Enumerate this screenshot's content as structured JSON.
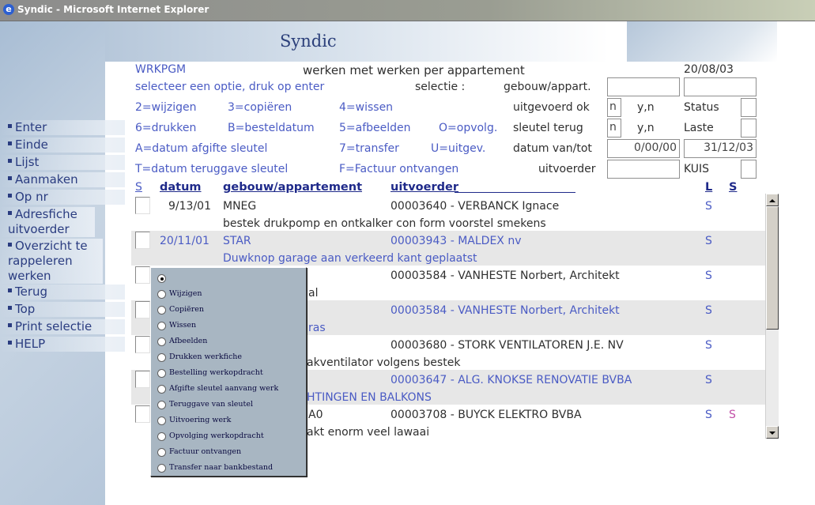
{
  "window": {
    "title": "Syndic - Microsoft Internet Explorer"
  },
  "app": {
    "title": "Syndic"
  },
  "header": {
    "program": "WRKPGM",
    "heading": "werken met werken per appartement",
    "date": "20/08/03",
    "instruction": "selecteer een optie, druk op enter",
    "selection_label": "selectie :",
    "building_label": "gebouw/appart."
  },
  "options": {
    "o1": "2=wijzigen",
    "o2": "3=copiëren",
    "o3": "4=wissen",
    "o4": "6=drukken",
    "o5": "B=besteldatum",
    "o6": "5=afbeelden",
    "o7": "O=opvolg.",
    "o8": "A=datum afgifte sleutel",
    "o9": "7=transfer",
    "o10": "U=uitgev.",
    "o11": "T=datum teruggave sleutel",
    "o12": "F=Factuur ontvangen"
  },
  "filters": {
    "executed_label": "uitgevoerd ok",
    "executed_value": "n",
    "executed_hint": "y,n",
    "status_label": "Status",
    "key_label": "sleutel terug",
    "key_value": "n",
    "key_hint": "y,n",
    "last_label": "Laste",
    "date_label": "datum van/tot",
    "date_from": "0/00/00",
    "date_to": "31/12/03",
    "contractor_label": "uitvoerder",
    "contractor_note": "KUIS"
  },
  "nav": {
    "items": [
      {
        "label": "Enter"
      },
      {
        "label": "Einde"
      },
      {
        "label": "Lijst"
      },
      {
        "label": "Aanmaken"
      },
      {
        "label": "Op nr"
      },
      {
        "label": "Adresfiche uitvoerder"
      },
      {
        "label": "Overzicht te rappeleren werken"
      },
      {
        "label": "Terug"
      },
      {
        "label": "Top"
      },
      {
        "label": "Print selectie"
      },
      {
        "label": "HELP"
      }
    ]
  },
  "table": {
    "headers": {
      "sel": "S",
      "date": "datum",
      "building": "gebouw/appartement",
      "contractor": "uitvoerder",
      "l": "L",
      "s": "S"
    },
    "rows": [
      {
        "date": "9/13/01",
        "building": "MNEG",
        "contractor": "00003640 - VERBANCK Ignace",
        "l": "S",
        "s": "",
        "desc": "bestek drukpomp en ontkalker con form voorstel smekens"
      },
      {
        "date": "20/11/01",
        "building": "STAR",
        "contractor": "00003943 - MALDEX nv",
        "l": "S",
        "s": "",
        "desc": "Duwknop garage aan verkeerd kant geplaatst"
      },
      {
        "date": "",
        "building": "",
        "contractor": "00003584 - VANHESTE Norbert, Architekt",
        "l": "S",
        "s": "",
        "desc": "al"
      },
      {
        "date": "",
        "building": "",
        "contractor": "00003584 - VANHESTE Norbert, Architekt",
        "l": "S",
        "s": "",
        "desc": "ras"
      },
      {
        "date": "",
        "building": "",
        "contractor": "00003680 - STORK VENTILATOREN J.E. NV",
        "l": "S",
        "s": "",
        "desc": "akventilator volgens bestek"
      },
      {
        "date": "",
        "building": "",
        "contractor": "00003647 - ALG. KNOKSE RENOVATIE BVBA",
        "l": "S",
        "s": "",
        "desc": "HTINGEN EN BALKONS"
      },
      {
        "date": "",
        "building": "A0",
        "contractor": "00003708 - BUYCK ELEKTRO BVBA",
        "l": "S",
        "s": "S",
        "desc": "akt enorm veel lawaai"
      }
    ]
  },
  "popup": {
    "options": [
      {
        "label": ""
      },
      {
        "label": "Wijzigen"
      },
      {
        "label": "Copiëren"
      },
      {
        "label": "Wissen"
      },
      {
        "label": "Afbeelden"
      },
      {
        "label": "Drukken werkfiche"
      },
      {
        "label": "Bestelling werkopdracht"
      },
      {
        "label": "Afgifte sleutel aanvang werk"
      },
      {
        "label": "Teruggave van sleutel"
      },
      {
        "label": "Uitvoering werk"
      },
      {
        "label": "Opvolging werkopdracht"
      },
      {
        "label": "Factuur ontvangen"
      },
      {
        "label": "Transfer naar bankbestand"
      }
    ]
  }
}
